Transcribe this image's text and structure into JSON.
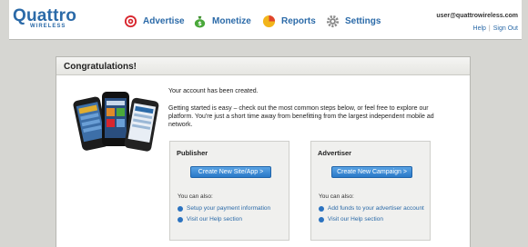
{
  "header": {
    "logo": {
      "main": "uattro",
      "q": "Q",
      "sub": "WIRELESS"
    },
    "nav": [
      {
        "label": "Advertise",
        "icon": "target-icon"
      },
      {
        "label": "Monetize",
        "icon": "money-bag-icon"
      },
      {
        "label": "Reports",
        "icon": "pie-chart-icon"
      },
      {
        "label": "Settings",
        "icon": "gear-icon"
      }
    ],
    "user_email": "user@quattrowireless.com",
    "help": "Help",
    "sign_out": "Sign Out"
  },
  "panel": {
    "title": "Congratulations!",
    "intro_1": "Your account has been created.",
    "intro_2": "Getting started is easy – check out the most common steps below, or feel free to explore our platform. You're just a short time away from benefitting from the largest independent mobile ad network."
  },
  "publisher": {
    "title": "Publisher",
    "button": "Create New Site/App >",
    "also": "You can also:",
    "links": [
      "Setup your payment information",
      "Visit our Help section"
    ]
  },
  "advertiser": {
    "title": "Advertiser",
    "button": "Create New Campaign >",
    "also": "You can also:",
    "links": [
      "Add funds to your advertiser account",
      "Visit our Help section"
    ]
  },
  "colors": {
    "brand": "#2b6aa8",
    "button": "#2a79c8",
    "background": "#d6d6d2"
  }
}
